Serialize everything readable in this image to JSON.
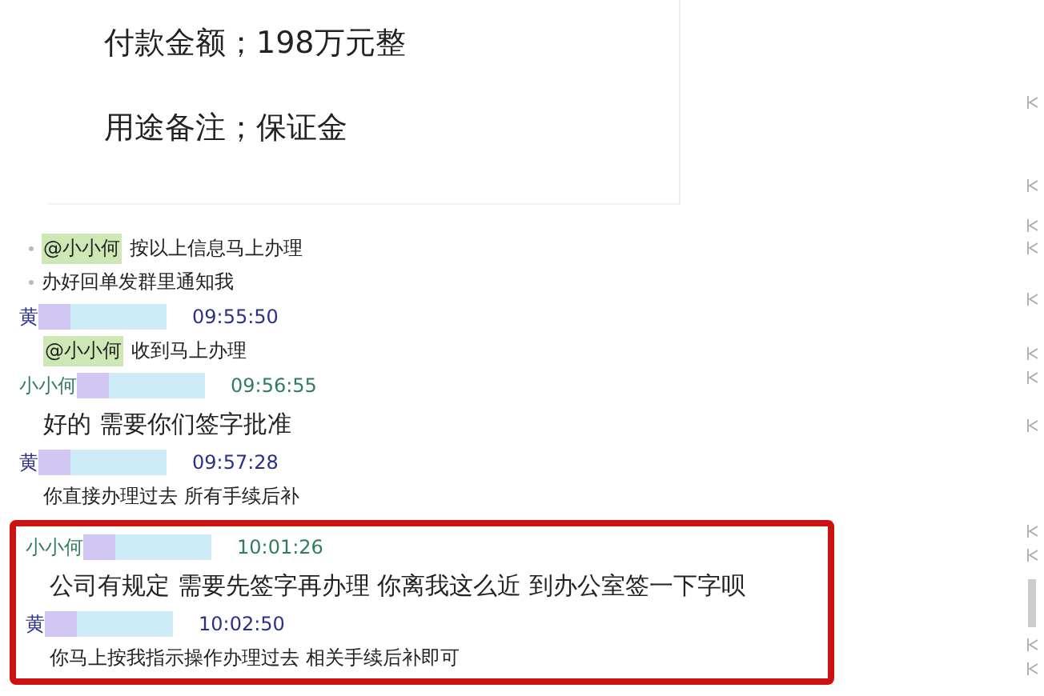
{
  "payment_card": {
    "lines": [
      "付款金额；198万元整",
      "用途备注；保证金"
    ]
  },
  "chat": [
    {
      "kind": "bullet-message",
      "mention": "@小小何",
      "text": "按以上信息马上办理"
    },
    {
      "kind": "bullet-message",
      "text": "办好回单发群里通知我"
    },
    {
      "kind": "header",
      "name": "黄",
      "color": "#2b2f8c",
      "time": "09:55:50"
    },
    {
      "kind": "message",
      "mention": "@小小何",
      "text": "收到马上办理"
    },
    {
      "kind": "header",
      "name": "小小何",
      "color": "#2e7d5b",
      "time": "09:56:55"
    },
    {
      "kind": "large-message",
      "text": "好的  需要你们签字批准"
    },
    {
      "kind": "header",
      "name": "黄",
      "color": "#2b2f8c",
      "time": "09:57:28"
    },
    {
      "kind": "message",
      "text": "你直接办理过去 所有手续后补"
    }
  ],
  "highlighted_chat": [
    {
      "kind": "header",
      "name": "小小何",
      "color": "#2e7d5b",
      "time": "10:01:26"
    },
    {
      "kind": "large-message",
      "text": "公司有规定  需要先签字再办理   你离我这么近 到办公室签一下字呗"
    },
    {
      "kind": "header",
      "name": "黄",
      "color": "#2b2f8c",
      "time": "10:02:50"
    },
    {
      "kind": "message",
      "text": "你马上按我指示操作办理过去   相关手续后补即可"
    }
  ]
}
